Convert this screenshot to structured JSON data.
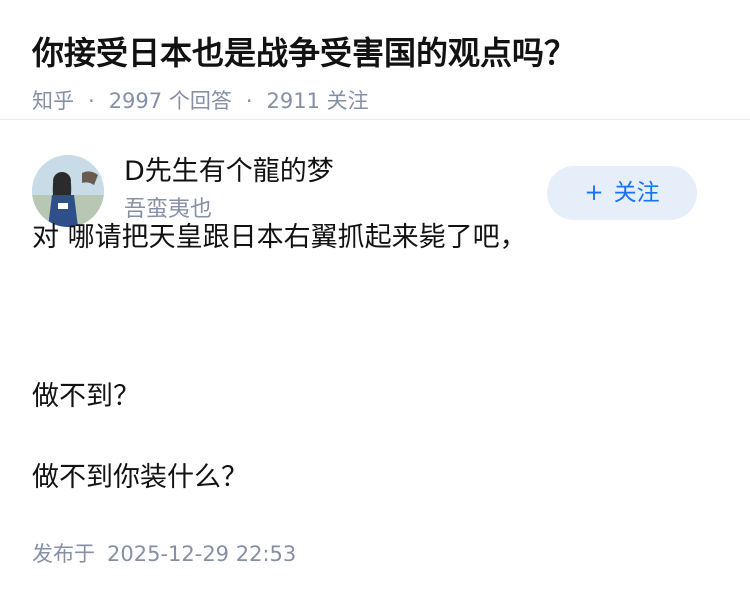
{
  "question": {
    "title": "你接受日本也是战争受害国的观点吗？",
    "source": "知乎",
    "separator": "·",
    "answers_count": "2997",
    "answers_label": "个回答",
    "followers_count": "2911",
    "followers_label": "关注"
  },
  "answer": {
    "author_name": "D先生有个龍的梦",
    "author_bio": "吾蛮夷也",
    "follow_button": {
      "icon": "+",
      "label": "关注"
    },
    "paragraphs": [
      "对 哪请把天皇跟日本右翼抓起来毙了吧，",
      "做不到？",
      "做不到你装什么？"
    ],
    "published_label": "发布于",
    "published_time": "2025-12-29 22:53"
  },
  "colors": {
    "meta_gray": "#8590a6",
    "accent_blue": "#1772f6",
    "follow_bg": "#e6eff9"
  }
}
